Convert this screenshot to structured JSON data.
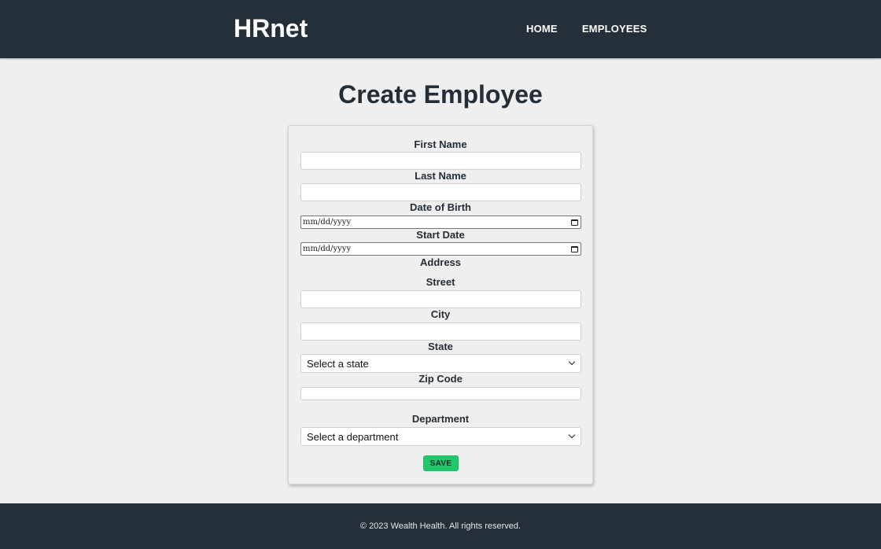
{
  "header": {
    "logo": "HRnet",
    "nav": [
      {
        "label": "HOME"
      },
      {
        "label": "EMPLOYEES"
      }
    ]
  },
  "page": {
    "title": "Create Employee"
  },
  "form": {
    "first_name": {
      "label": "First Name",
      "value": ""
    },
    "last_name": {
      "label": "Last Name",
      "value": ""
    },
    "date_of_birth": {
      "label": "Date of Birth",
      "placeholder": "mm/dd/yyyy"
    },
    "start_date": {
      "label": "Start Date",
      "placeholder": "mm/dd/yyyy"
    },
    "address_heading": "Address",
    "street": {
      "label": "Street",
      "value": ""
    },
    "city": {
      "label": "City",
      "value": ""
    },
    "state": {
      "label": "State",
      "selected": "Select a state"
    },
    "zip_code": {
      "label": "Zip Code",
      "value": ""
    },
    "department": {
      "label": "Department",
      "selected": "Select a department"
    },
    "save_label": "SAVE"
  },
  "footer": {
    "text": "© 2023 Wealth Health. All rights reserved."
  },
  "colors": {
    "header_bg": "#252f3a",
    "page_bg": "#efefef",
    "save_button": "#22c86a",
    "text_dark": "#242e38"
  }
}
